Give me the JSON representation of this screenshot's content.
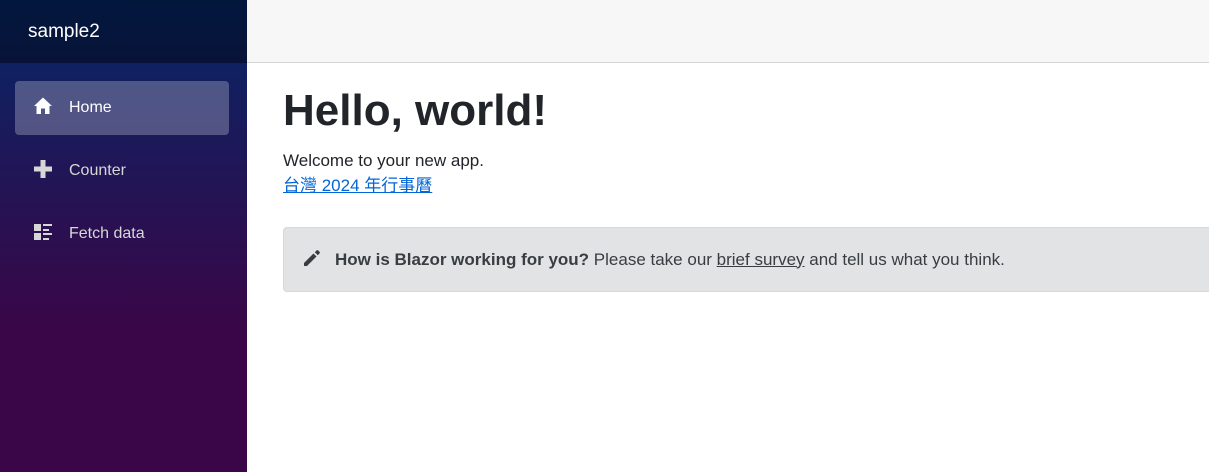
{
  "sidebar": {
    "brand": "sample2",
    "items": [
      {
        "label": "Home",
        "icon": "home-icon",
        "active": true
      },
      {
        "label": "Counter",
        "icon": "plus-icon",
        "active": false
      },
      {
        "label": "Fetch data",
        "icon": "list-rich-icon",
        "active": false
      }
    ]
  },
  "main": {
    "title": "Hello, world!",
    "welcome": "Welcome to your new app.",
    "link_text": "台灣 2024 年行事曆",
    "survey": {
      "icon": "pencil-icon",
      "question": "How is Blazor working for you?",
      "pre_link": " Please take our ",
      "link_text": "brief survey",
      "post_link": " and tell us what you think."
    }
  },
  "colors": {
    "sidebar_top": "#052767",
    "sidebar_bottom": "#3a0647",
    "link": "#0366d6",
    "survey_bg": "#e2e3e5",
    "top_row_bg": "#f7f7f7"
  }
}
